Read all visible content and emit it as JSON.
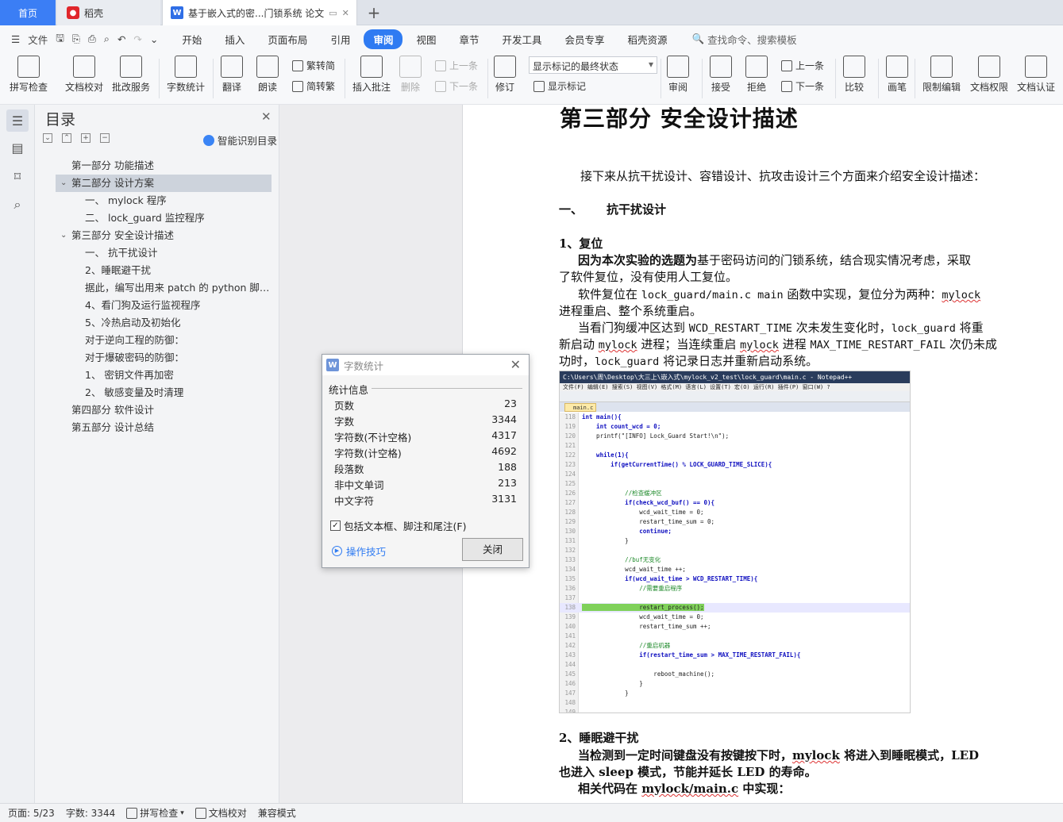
{
  "tabs": {
    "home": "首页",
    "daoke": "稻壳",
    "doc": "基于嵌入式的密...门锁系统 论文"
  },
  "menu": {
    "file": "文件",
    "tabs": [
      "开始",
      "插入",
      "页面布局",
      "引用",
      "审阅",
      "视图",
      "章节",
      "开发工具",
      "会员专享",
      "稻壳资源"
    ],
    "active_tab": "审阅",
    "search": "查找命令、搜索模板"
  },
  "ribbon": {
    "spellcheck": "拼写检查",
    "doc_check": "文档校对",
    "annotate_service": "批改服务",
    "word_count": "字数统计",
    "translate": "翻译",
    "read_aloud": "朗读",
    "trad_to_simp": "繁转简",
    "simp_to_trad": "简转繁",
    "insert_comment": "插入批注",
    "delete": "删除",
    "prev": "上一条",
    "next": "下一条",
    "revise": "修订",
    "show_mode": "显示标记的最终状态",
    "show_marks": "显示标记",
    "review": "审阅",
    "accept": "接受",
    "reject": "拒绝",
    "prev2": "上一条",
    "next2": "下一条",
    "compare": "比较",
    "pen": "画笔",
    "restrict_edit": "限制编辑",
    "doc_permission": "文档权限",
    "doc_cert": "文档认证"
  },
  "toc": {
    "title": "目录",
    "smart": "智能识别目录",
    "items": [
      {
        "label": "第一部分 功能描述",
        "level": 1
      },
      {
        "label": "第二部分 设计方案",
        "level": 1
      },
      {
        "label": "一、 mylock 程序",
        "level": 2
      },
      {
        "label": "二、 lock_guard 监控程序",
        "level": 2
      },
      {
        "label": "第三部分 安全设计描述",
        "level": 1
      },
      {
        "label": "一、 抗干扰设计",
        "level": 2
      },
      {
        "label": "2、睡眠避干扰",
        "level": 2
      },
      {
        "label": "据此，编写出用来 patch 的 python 脚本：",
        "level": 2
      },
      {
        "label": "4、看门狗及运行监视程序",
        "level": 2
      },
      {
        "label": "5、冷热启动及初始化",
        "level": 2
      },
      {
        "label": "对于逆向工程的防御：",
        "level": 2
      },
      {
        "label": "对于爆破密码的防御：",
        "level": 2
      },
      {
        "label": "1、 密钥文件再加密",
        "level": 2
      },
      {
        "label": "2、 敏感变量及时清理",
        "level": 2
      },
      {
        "label": "第四部分 软件设计",
        "level": 1
      },
      {
        "label": "第五部分 设计总结",
        "level": 1
      }
    ]
  },
  "doc": {
    "heading": "第三部分  安全设计描述",
    "intro": "接下来从抗干扰设计、容错设计、抗攻击设计三个方面来介绍安全设计描述：",
    "sec1_num": "一、",
    "sec1": "抗干扰设计",
    "sub1": "1、复位",
    "p1_bold": "因为本次实验的选题为",
    "p1_rest": "基于密码访问的门锁系统，结合现实情况考虑，采取",
    "p1_line2": "了软件复位，没有使用人工复位。",
    "p2_a": "软件复位在 ",
    "p2_code1": "lock_guard/main.c main",
    "p2_b": " 函数中实现，复位分为两种：",
    "p2_code2": "mylock",
    "p2_line2": "进程重启、整个系统重启。",
    "p3_a": "当看门狗缓冲区达到 ",
    "p3_code1": "WCD_RESTART_TIME",
    "p3_b": " 次未发生变化时，",
    "p3_code2": "lock_guard",
    "p3_c": " 将重",
    "p3_l2a": "新启动 ",
    "p3_l2code": "mylock",
    "p3_l2b": " 进程；当连续重启 ",
    "p3_l2code2": "mylock",
    "p3_l2c": " 进程 ",
    "p3_l2code3": "MAX_TIME_RESTART_FAIL",
    "p3_l2d": " 次仍未成",
    "p3_l3a": "功时，",
    "p3_l3code": "lock_guard",
    "p3_l3b": " 将记录日志并重新启动系统。",
    "sub2": "2、睡眠避干扰",
    "p4_a": "当检测到一定时间键盘没有按键按下时，",
    "p4_code": "mylock",
    "p4_b": " 将进入到睡眠模式，",
    "p4_c": "LED",
    "p4_l2": "也进入  sleep 模式，节能并延长  LED 的寿命。",
    "p5_a": "相关代码在  ",
    "p5_code": "mylock/main.c",
    "p5_b": "  中实现："
  },
  "code": {
    "title": "C:\\Users\\周\\Desktop\\大三上\\嵌入式\\mylock_v2_test\\lock_guard\\main.c - Notepad++",
    "menu": "文件(F)  编辑(E)  搜索(S)  视图(V)  格式(M)  语言(L)  设置(T)  宏(O)  运行(R)  插件(P)  窗口(W)  ?",
    "tab": "main.c",
    "lines": [
      {
        "n": "118",
        "t": "int main(){"
      },
      {
        "n": "119",
        "t": "    int count_wcd = 0;"
      },
      {
        "n": "120",
        "t": "    printf(\"[INFO] Lock_Guard Start!\\n\");"
      },
      {
        "n": "121",
        "t": ""
      },
      {
        "n": "122",
        "t": "    while(1){"
      },
      {
        "n": "123",
        "t": "        if(getCurrentTime() % LOCK_GUARD_TIME_SLICE){"
      },
      {
        "n": "124",
        "t": ""
      },
      {
        "n": "125",
        "t": ""
      },
      {
        "n": "126",
        "t": "            //检查缓冲区"
      },
      {
        "n": "127",
        "t": "            if(check_wcd_buf() == 0){"
      },
      {
        "n": "128",
        "t": "                wcd_wait_time = 0;"
      },
      {
        "n": "129",
        "t": "                restart_time_sum = 0;"
      },
      {
        "n": "130",
        "t": "                continue;"
      },
      {
        "n": "131",
        "t": "            }"
      },
      {
        "n": "132",
        "t": ""
      },
      {
        "n": "133",
        "t": "            //buf无变化"
      },
      {
        "n": "134",
        "t": "            wcd_wait_time ++;"
      },
      {
        "n": "135",
        "t": "            if(wcd_wait_time > WCD_RESTART_TIME){"
      },
      {
        "n": "136",
        "t": "                //需要重启程序"
      },
      {
        "n": "137",
        "t": ""
      },
      {
        "n": "138",
        "t": "                restart_process();"
      },
      {
        "n": "139",
        "t": "                wcd_wait_time = 0;"
      },
      {
        "n": "140",
        "t": "                restart_time_sum ++;"
      },
      {
        "n": "141",
        "t": ""
      },
      {
        "n": "142",
        "t": "                //重启机器"
      },
      {
        "n": "143",
        "t": "                if(restart_time_sum > MAX_TIME_RESTART_FAIL){"
      },
      {
        "n": "144",
        "t": ""
      },
      {
        "n": "145",
        "t": "                    reboot_machine();"
      },
      {
        "n": "146",
        "t": "                }"
      },
      {
        "n": "147",
        "t": "            }"
      },
      {
        "n": "148",
        "t": ""
      },
      {
        "n": "149",
        "t": ""
      }
    ]
  },
  "dialog": {
    "title": "字数统计",
    "section": "统计信息",
    "stats": [
      {
        "label": "页数",
        "value": "23"
      },
      {
        "label": "字数",
        "value": "3344"
      },
      {
        "label": "字符数(不计空格)",
        "value": "4317"
      },
      {
        "label": "字符数(计空格)",
        "value": "4692"
      },
      {
        "label": "段落数",
        "value": "188"
      },
      {
        "label": "非中文单词",
        "value": "213"
      },
      {
        "label": "中文字符",
        "value": "3131"
      }
    ],
    "include": "包括文本框、脚注和尾注(F)",
    "include_checked": true,
    "tips": "操作技巧",
    "close": "关闭"
  },
  "status": {
    "page": "页面: 5/23",
    "words": "字数: 3344",
    "spell": "拼写检查",
    "proof": "文档校对",
    "compat": "兼容模式"
  }
}
